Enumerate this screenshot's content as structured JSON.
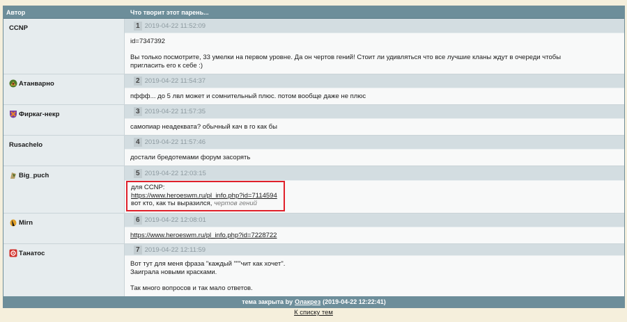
{
  "header": {
    "author_col": "Автор",
    "topic_col": "Что творит этот парень..."
  },
  "posts": [
    {
      "author": "CCNP",
      "icon": "",
      "num": "1",
      "date": "2019-04-22 11:52:09",
      "lines": [
        "id=7347392",
        "",
        "Вы только посмотрите, 33 умелки на первом уровне. Да он чертов гений! Стоит ли удивляться что все лучшие кланы ждут в очереди чтобы",
        "пригласить его к себе :)"
      ]
    },
    {
      "author": "Атанварно",
      "icon": "clan-emblem-icon",
      "num": "2",
      "date": "2019-04-22 11:54:37",
      "lines": [
        "пффф... до 5 лвл может и сомнительный плюс. потом вообще даже не плюс"
      ]
    },
    {
      "author": "Фиркаг-некр",
      "icon": "clan-emblem-icon",
      "num": "3",
      "date": "2019-04-22 11:57:35",
      "lines": [
        "самопиар неадеквата? обычный кач в го как бы"
      ]
    },
    {
      "author": "Rusachelo",
      "icon": "",
      "num": "4",
      "date": "2019-04-22 11:57:46",
      "lines": [
        "достали бредотемами форум засорять"
      ]
    },
    {
      "author": "Big_puch",
      "icon": "clan-emblem-icon",
      "num": "5",
      "date": "2019-04-22 12:03:15",
      "lines": [
        "для CCNP:",
        "https://www.heroeswm.ru/pl_info.php?id=7114594",
        "вот кто, как ты выразился,"
      ],
      "muted": "чертов гений"
    },
    {
      "author": "Mirn",
      "icon": "clan-emblem-icon",
      "num": "6",
      "date": "2019-04-22 12:08:01",
      "lines": [
        "https://www.heroeswm.ru/pl_info.php?id=7228722"
      ]
    },
    {
      "author": "Танатос",
      "icon": "clan-emblem-icon",
      "num": "7",
      "date": "2019-04-22 12:11:59",
      "lines": [
        "Вот тут для меня фраза \"каждый \"\"\"чит как хочет\".",
        "Заиграла новыми красками.",
        "",
        "Так много вопросов и так мало ответов."
      ]
    }
  ],
  "footer": {
    "prefix": "тема закрыта by",
    "user": "Олакрез",
    "suffix": "(2019-04-22 12:22:41)"
  },
  "back_link": "К списку тем",
  "colors": {
    "header_bg": "#6d8e9a",
    "author_bg": "#e6ecee",
    "meta_bg": "#d3dde1",
    "highlight": "#e0202a"
  }
}
